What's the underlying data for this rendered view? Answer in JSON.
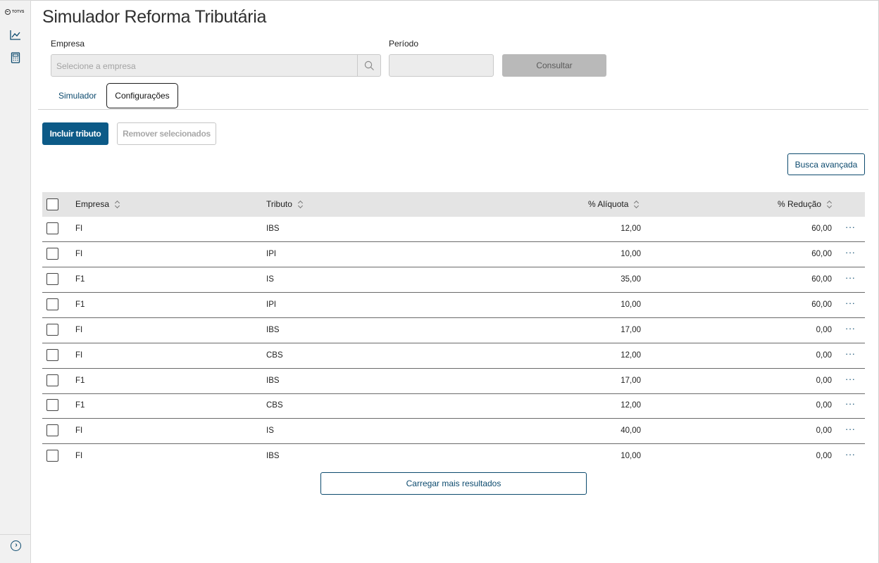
{
  "app": {
    "logo_text": "TOTVS",
    "title": "Simulador Reforma Tributária"
  },
  "sidebar": {
    "items": [
      {
        "icon": "chart-line-icon"
      },
      {
        "icon": "calculator-icon"
      }
    ],
    "collapse_icon": "chevron-right-circle-icon"
  },
  "filters": {
    "empresa_label": "Empresa",
    "empresa_placeholder": "Selecione a empresa",
    "periodo_label": "Período",
    "consultar_label": "Consultar"
  },
  "tabs": [
    {
      "label": "Simulador",
      "active": false
    },
    {
      "label": "Configurações",
      "active": true
    }
  ],
  "actions": {
    "incluir_label": "Incluir tributo",
    "remover_label": "Remover selecionados",
    "busca_label": "Busca avançada"
  },
  "table": {
    "columns": [
      "Empresa",
      "Tributo",
      "% Alíquota",
      "% Redução"
    ],
    "more_label": "···",
    "rows": [
      {
        "empresa": "FI",
        "tributo": "IBS",
        "aliquota": "12,00",
        "reducao": "60,00"
      },
      {
        "empresa": "FI",
        "tributo": "IPI",
        "aliquota": "10,00",
        "reducao": "60,00"
      },
      {
        "empresa": "F1",
        "tributo": "IS",
        "aliquota": "35,00",
        "reducao": "60,00"
      },
      {
        "empresa": "F1",
        "tributo": "IPI",
        "aliquota": "10,00",
        "reducao": "60,00"
      },
      {
        "empresa": "FI",
        "tributo": "IBS",
        "aliquota": "17,00",
        "reducao": "0,00"
      },
      {
        "empresa": "FI",
        "tributo": "CBS",
        "aliquota": "12,00",
        "reducao": "0,00"
      },
      {
        "empresa": "F1",
        "tributo": "IBS",
        "aliquota": "17,00",
        "reducao": "0,00"
      },
      {
        "empresa": "F1",
        "tributo": "CBS",
        "aliquota": "12,00",
        "reducao": "0,00"
      },
      {
        "empresa": "FI",
        "tributo": "IS",
        "aliquota": "40,00",
        "reducao": "0,00"
      },
      {
        "empresa": "FI",
        "tributo": "IBS",
        "aliquota": "10,00",
        "reducao": "0,00"
      }
    ]
  },
  "footer": {
    "carregar_label": "Carregar mais resultados"
  },
  "colors": {
    "primary": "#0c5a87",
    "link": "#0c4a6e",
    "header_bg": "#e4e4e4",
    "disabled_btn": "#b9b9b9"
  }
}
